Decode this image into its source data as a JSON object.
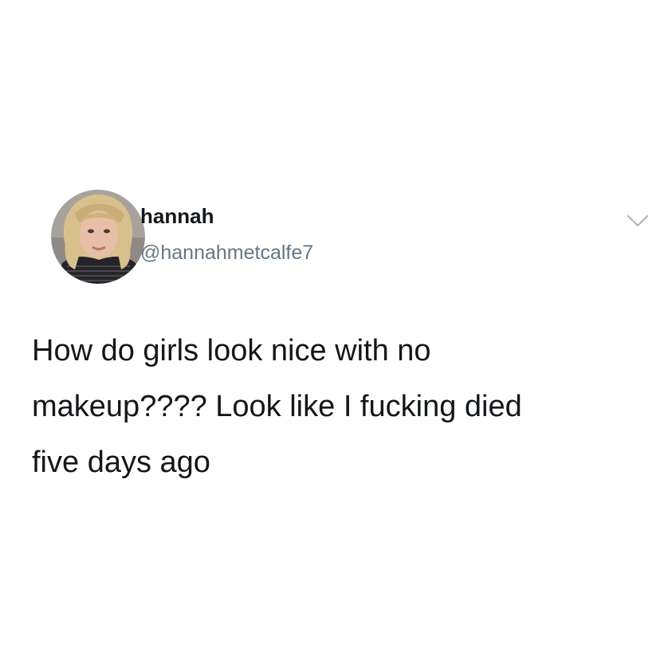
{
  "tweet": {
    "author": {
      "display_name": "hannah",
      "handle": "@hannahmetcalfe7",
      "avatar_icon": "profile-photo"
    },
    "menu_icon": "chevron-down-icon",
    "text": "How do girls look nice with no\nmakeup???? Look like I fucking died\nfive days ago"
  },
  "colors": {
    "background": "#ffffff",
    "primary_text": "#14171a",
    "secondary_text": "#657786",
    "caret": "#aab8c2"
  }
}
